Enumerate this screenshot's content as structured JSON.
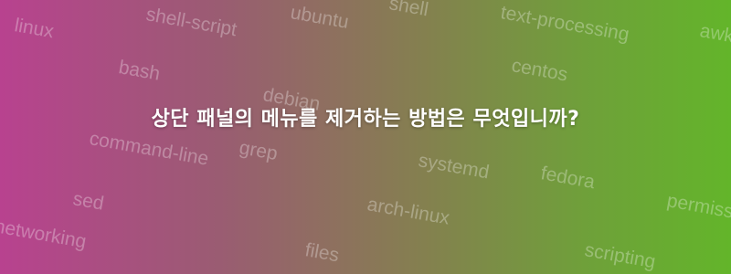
{
  "title": "상단 패널의 메뉴를 제거하는 방법은 무엇입니까?",
  "tags": [
    "linux",
    "shell-script",
    "ubuntu",
    "shell",
    "text-processing",
    "awk",
    "bash",
    "centos",
    "debian",
    "command-line",
    "grep",
    "systemd",
    "fedora",
    "sed",
    "arch-linux",
    "permissions",
    "networking",
    "files",
    "scripting"
  ],
  "colors": {
    "gradient_left": "#b8428f",
    "gradient_right": "#63b52a",
    "title": "#ffffff"
  }
}
